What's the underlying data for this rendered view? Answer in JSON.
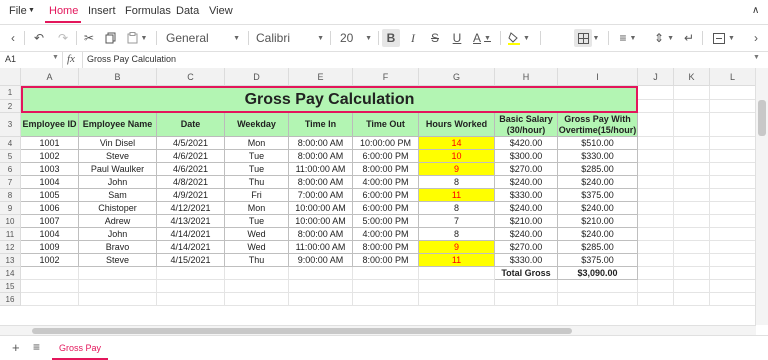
{
  "menu": {
    "file": "File",
    "tabs": [
      "Home",
      "Insert",
      "Formulas",
      "Data",
      "View"
    ],
    "active": "Home"
  },
  "toolbar": {
    "number_format": "General",
    "font_family": "Calibri",
    "font_size": "20"
  },
  "formula_bar": {
    "cell_ref": "A1",
    "fx": "fx",
    "value": "Gross Pay Calculation"
  },
  "columns": [
    "A",
    "B",
    "C",
    "D",
    "E",
    "F",
    "G",
    "H",
    "I",
    "J",
    "K",
    "L"
  ],
  "rows": [
    "1",
    "2",
    "3",
    "4",
    "5",
    "6",
    "7",
    "8",
    "9",
    "10",
    "11",
    "12",
    "13",
    "14",
    "15",
    "16"
  ],
  "title": "Gross Pay Calculation",
  "headers": [
    "Employee ID",
    "Employee Name",
    "Date",
    "Weekday",
    "Time In",
    "Time Out",
    "Hours Worked",
    "Basic Salary (30/hour)",
    "Gross Pay With Overtime(15/hour)"
  ],
  "records": [
    [
      "1001",
      "Vin Disel",
      "4/5/2021",
      "Mon",
      "8:00:00 AM",
      "10:00:00 PM",
      "14",
      "$420.00",
      "$510.00"
    ],
    [
      "1002",
      "Steve",
      "4/6/2021",
      "Tue",
      "8:00:00 AM",
      "6:00:00 PM",
      "10",
      "$300.00",
      "$330.00"
    ],
    [
      "1003",
      "Paul Waulker",
      "4/6/2021",
      "Tue",
      "11:00:00 AM",
      "8:00:00 PM",
      "9",
      "$270.00",
      "$285.00"
    ],
    [
      "1004",
      "John",
      "4/8/2021",
      "Thu",
      "8:00:00 AM",
      "4:00:00 PM",
      "8",
      "$240.00",
      "$240.00"
    ],
    [
      "1005",
      "Sam",
      "4/9/2021",
      "Fri",
      "7:00:00 AM",
      "6:00:00 PM",
      "11",
      "$330.00",
      "$375.00"
    ],
    [
      "1006",
      "Chistoper",
      "4/12/2021",
      "Mon",
      "10:00:00 AM",
      "6:00:00 PM",
      "8",
      "$240.00",
      "$240.00"
    ],
    [
      "1007",
      "Adrew",
      "4/13/2021",
      "Tue",
      "10:00:00 AM",
      "5:00:00 PM",
      "7",
      "$210.00",
      "$210.00"
    ],
    [
      "1004",
      "John",
      "4/14/2021",
      "Wed",
      "8:00:00 AM",
      "4:00:00 PM",
      "8",
      "$240.00",
      "$240.00"
    ],
    [
      "1009",
      "Bravo",
      "4/14/2021",
      "Wed",
      "11:00:00 AM",
      "8:00:00 PM",
      "9",
      "$270.00",
      "$285.00"
    ],
    [
      "1002",
      "Steve",
      "4/15/2021",
      "Thu",
      "9:00:00 AM",
      "8:00:00 PM",
      "11",
      "$330.00",
      "$375.00"
    ]
  ],
  "highlighted_hours": [
    true,
    true,
    true,
    false,
    true,
    false,
    false,
    false,
    true,
    true
  ],
  "total": {
    "label": "Total Gross",
    "value": "$3,090.00"
  },
  "sheet_tab": "Gross Pay",
  "colors": {
    "accent": "#e3165b",
    "header_fill": "#b3f5b3",
    "highlight_fill": "#ffff00",
    "highlight_text": "#ff0000"
  }
}
